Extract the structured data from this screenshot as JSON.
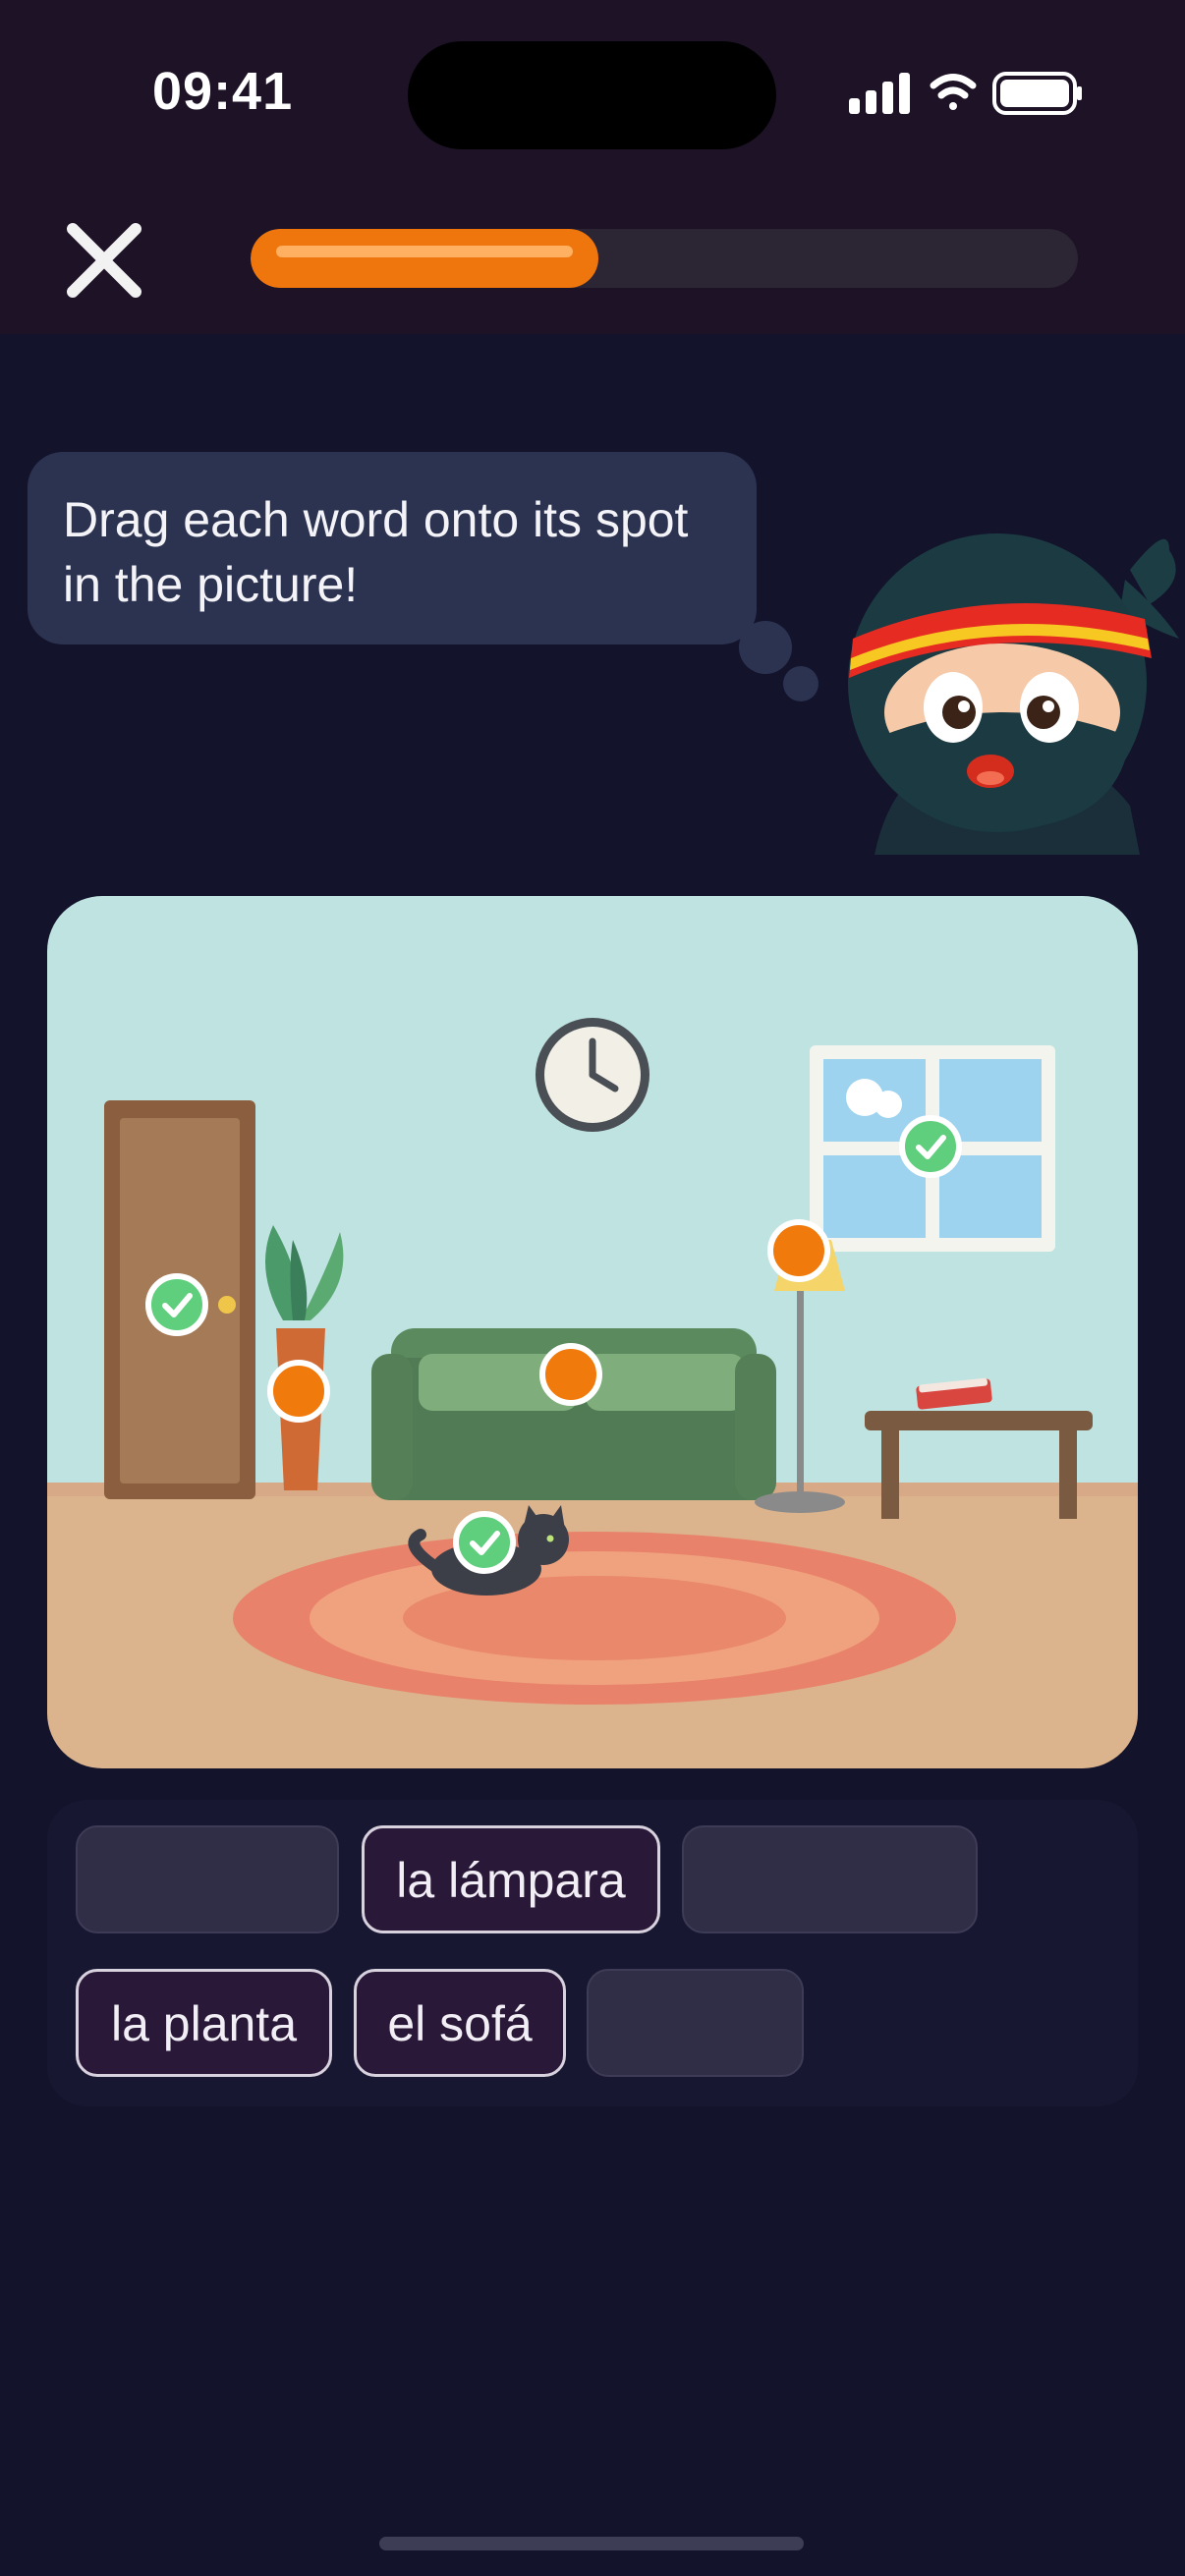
{
  "status_bar": {
    "time": "09:41"
  },
  "header": {
    "close_icon": "close-icon",
    "progress": 0.42,
    "progress_color": "#ef760d"
  },
  "prompt": {
    "text": "Drag each word onto its spot in the picture!",
    "mascot": "ninja-mascot"
  },
  "scene": {
    "description_icon": "living-room-illustration",
    "targets": [
      {
        "id": "door",
        "state": "done"
      },
      {
        "id": "plant",
        "state": "open"
      },
      {
        "id": "sofa",
        "state": "open"
      },
      {
        "id": "lamp",
        "state": "open"
      },
      {
        "id": "window",
        "state": "done"
      },
      {
        "id": "cat",
        "state": "done"
      }
    ]
  },
  "word_bank": {
    "slots": [
      {
        "label": "",
        "filled": false
      },
      {
        "label": "la lámpara",
        "filled": true
      },
      {
        "label": "",
        "filled": false
      },
      {
        "label": "la planta",
        "filled": true
      },
      {
        "label": "el sofá",
        "filled": true
      },
      {
        "label": "",
        "filled": false
      }
    ]
  },
  "colors": {
    "background": "#13132b",
    "accent": "#ef760d",
    "success": "#5fce7d"
  }
}
